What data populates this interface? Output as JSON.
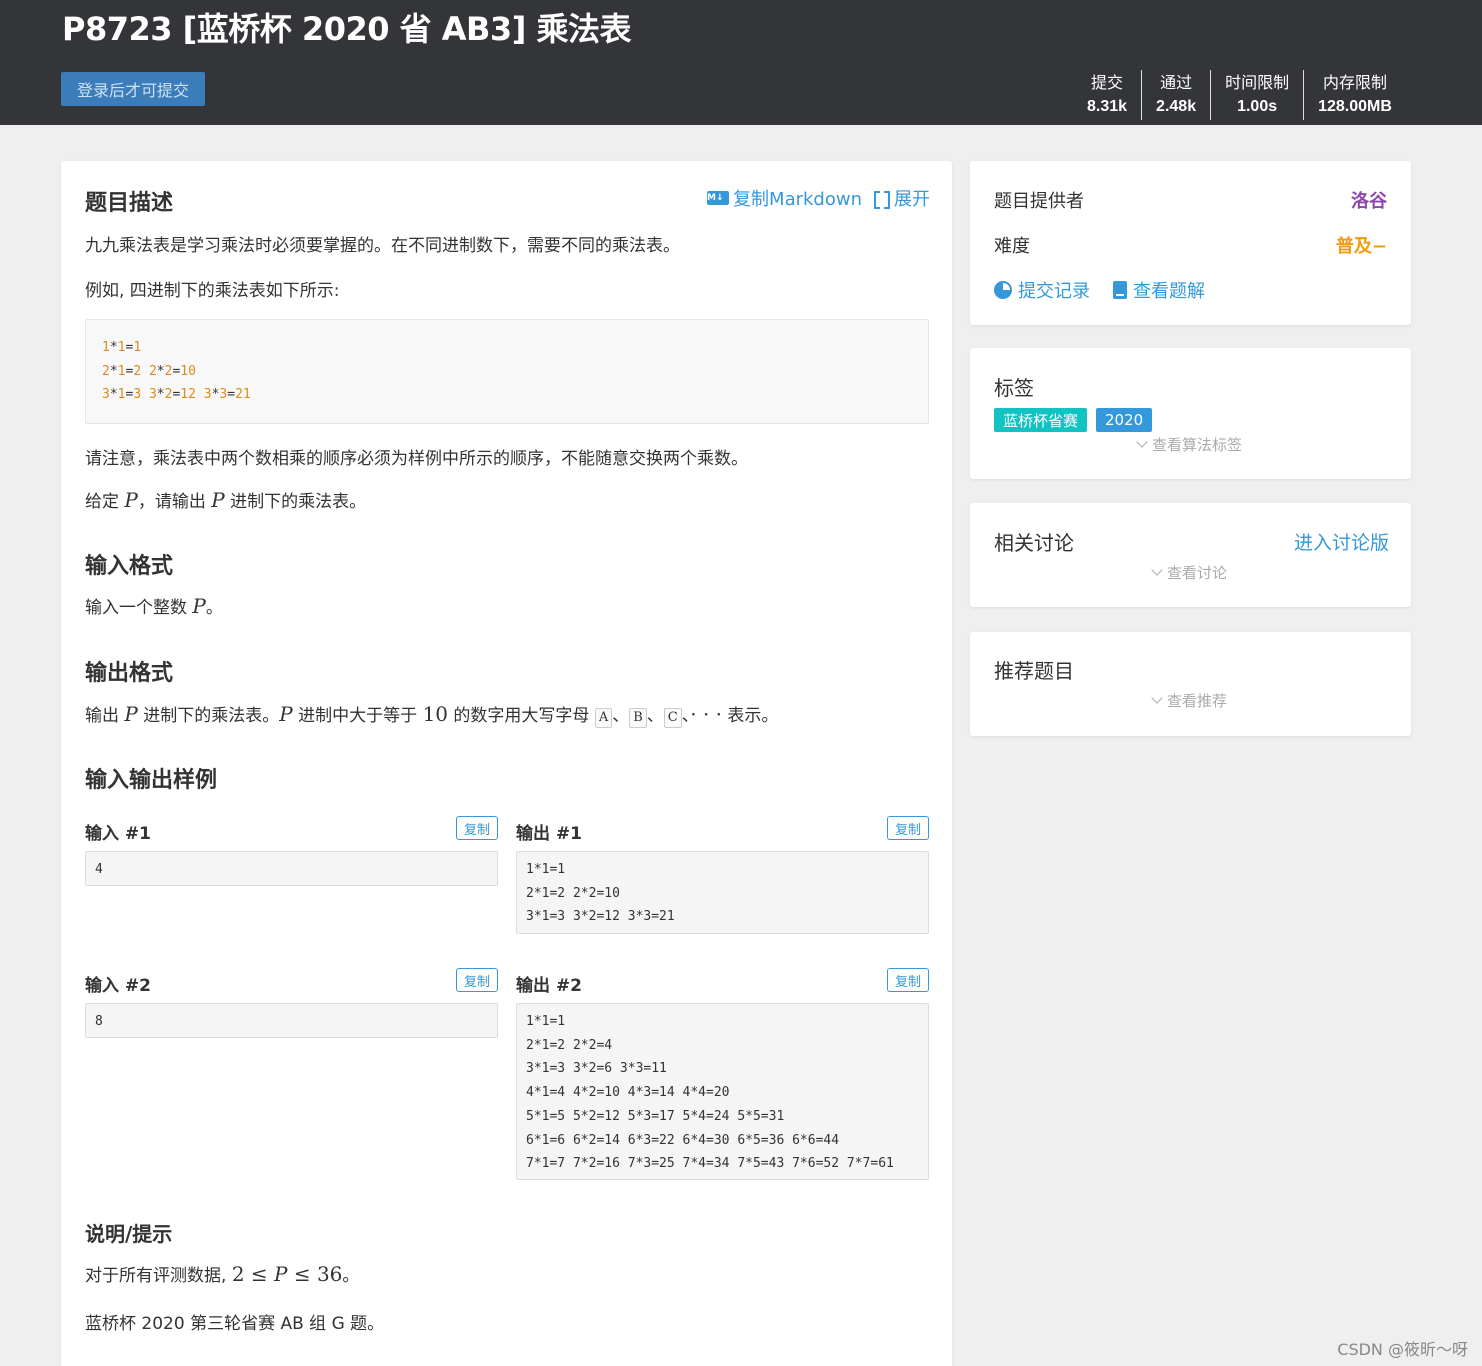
{
  "header": {
    "title": "P8723 [蓝桥杯 2020 省 AB3] 乘法表",
    "submit_label": "登录后才可提交",
    "stats": [
      {
        "label": "提交",
        "value": "8.31k"
      },
      {
        "label": "通过",
        "value": "2.48k"
      },
      {
        "label": "时间限制",
        "value": "1.00s"
      },
      {
        "label": "内存限制",
        "value": "128.00MB"
      }
    ]
  },
  "main": {
    "desc_heading": "题目描述",
    "copy_markdown": "复制Markdown",
    "md_icon_text": "M↓",
    "expand": "展开",
    "p1": "九九乘法表是学习乘法时必须要掌握的。在不同进制数下，需要不同的乘法表。",
    "p2": "例如, 四进制下的乘法表如下所示:",
    "code_lines": [
      [
        [
          "1",
          "n"
        ],
        [
          "*",
          "t"
        ],
        [
          "1",
          "n"
        ],
        [
          "=",
          "t"
        ],
        [
          "1",
          "n"
        ]
      ],
      [
        [
          "2",
          "n"
        ],
        [
          "*",
          "t"
        ],
        [
          "1",
          "n"
        ],
        [
          "=",
          "t"
        ],
        [
          "2",
          "n"
        ],
        [
          " ",
          "t"
        ],
        [
          "2",
          "n"
        ],
        [
          "*",
          "t"
        ],
        [
          "2",
          "n"
        ],
        [
          "=",
          "t"
        ],
        [
          "10",
          "n"
        ]
      ],
      [
        [
          "3",
          "n"
        ],
        [
          "*",
          "t"
        ],
        [
          "1",
          "n"
        ],
        [
          "=",
          "t"
        ],
        [
          "3",
          "n"
        ],
        [
          " ",
          "t"
        ],
        [
          "3",
          "n"
        ],
        [
          "*",
          "t"
        ],
        [
          "2",
          "n"
        ],
        [
          "=",
          "t"
        ],
        [
          "12",
          "n"
        ],
        [
          " ",
          "t"
        ],
        [
          "3",
          "n"
        ],
        [
          "*",
          "t"
        ],
        [
          "3",
          "n"
        ],
        [
          "=",
          "t"
        ],
        [
          "21",
          "n"
        ]
      ]
    ],
    "p3": "请注意，乘法表中两个数相乘的顺序必须为样例中所示的顺序，不能随意交换两个乘数。",
    "p4_a": "给定 ",
    "p4_var": "P",
    "p4_b": "，请输出 ",
    "p4_var2": "P",
    "p4_c": " 进制下的乘法表。",
    "input_heading": "输入格式",
    "input_a": "输入一个整数 ",
    "input_var": "P",
    "input_b": "。",
    "output_heading": "输出格式",
    "output_a": "输出 ",
    "output_var": "P",
    "output_b": " 进制下的乘法表。",
    "output_var2": "P",
    "output_c": " 进制中大于等于 ",
    "output_num": "10",
    "output_d": " 的数字用大写字母 ",
    "letter_a": "A",
    "letter_b": "B",
    "letter_c": "C",
    "sep": "、",
    "dots": "· · ·",
    "output_e": " 表示。",
    "samples_heading": "输入输出样例",
    "copy_label": "复制",
    "samples": [
      {
        "in_label": "输入 #1",
        "out_label": "输出 #1",
        "input": [
          "4"
        ],
        "output": [
          "1*1=1",
          "2*1=2 2*2=10",
          "3*1=3 3*2=12 3*3=21"
        ]
      },
      {
        "in_label": "输入 #2",
        "out_label": "输出 #2",
        "input": [
          "8"
        ],
        "output": [
          "1*1=1",
          "2*1=2 2*2=4",
          "3*1=3 3*2=6 3*3=11",
          "4*1=4 4*2=10 4*3=14 4*4=20",
          "5*1=5 5*2=12 5*3=17 5*4=24 5*5=31",
          "6*1=6 6*2=14 6*3=22 6*4=30 6*5=36 6*6=44",
          "7*1=7 7*2=16 7*3=25 7*4=34 7*5=43 7*6=52 7*7=61"
        ]
      }
    ],
    "hint_heading": "说明/提示",
    "hint1_a": "对于所有评测数据, ",
    "hint1_math_a": "2 ≤ ",
    "hint1_var": "P",
    "hint1_math_b": " ≤ 36",
    "hint1_b": "。",
    "hint2": "蓝桥杯 2020 第三轮省赛 AB 组 G 题。"
  },
  "side": {
    "provider_label": "题目提供者",
    "provider_value": "洛谷",
    "provider_color": "#8e44ad",
    "difficulty_label": "难度",
    "difficulty_value": "普及−",
    "difficulty_color": "#f39c11",
    "submit_records": "提交记录",
    "solutions": "查看题解",
    "tags_title": "标签",
    "tags": [
      {
        "label": "蓝桥杯省赛",
        "color": "#13c2c2"
      },
      {
        "label": "2020",
        "color": "#3498db"
      }
    ],
    "view_algo_tags": "查看算法标签",
    "discuss_title": "相关讨论",
    "enter_discuss": "进入讨论版",
    "view_discuss": "查看讨论",
    "recommend_title": "推荐题目",
    "view_recommend": "查看推荐"
  },
  "watermark": "CSDN @筱昕～呀"
}
